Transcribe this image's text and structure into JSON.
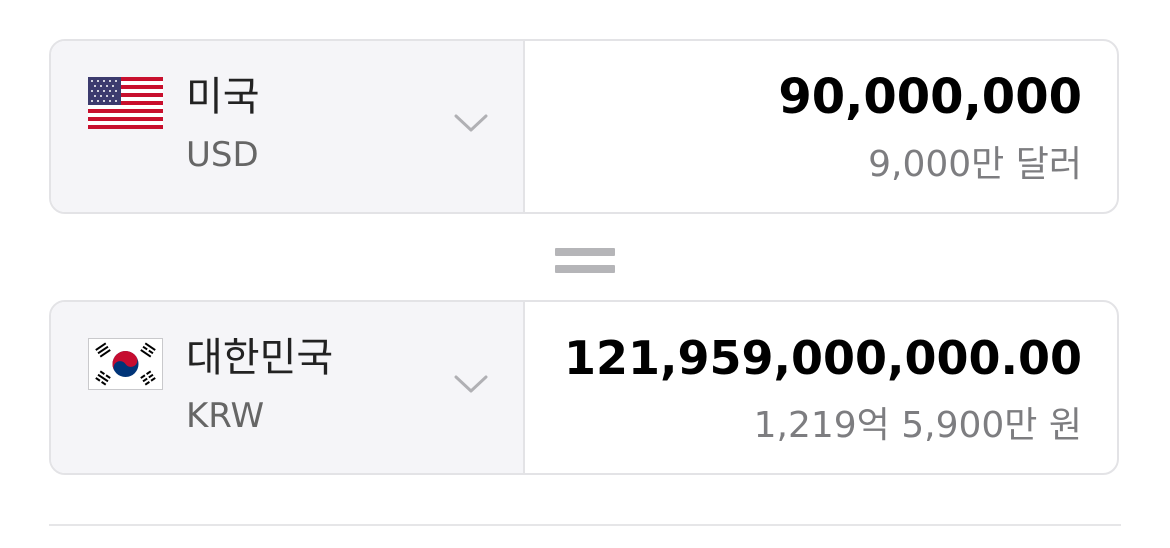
{
  "from_currency": {
    "country": "미국",
    "code": "USD",
    "flag_icon": "us-flag-icon",
    "amount": "90,000,000",
    "amount_words": "9,000만 달러"
  },
  "to_currency": {
    "country": "대한민국",
    "code": "KRW",
    "flag_icon": "kr-flag-icon",
    "amount": "121,959,000,000.00",
    "amount_words": "1,219억 5,900만 원"
  },
  "equals_icon": "equals-icon",
  "colors": {
    "selector_bg": "#f5f5f8",
    "border": "#e3e3e6",
    "amount": "#000000",
    "secondary_text": "#7d7d80"
  }
}
